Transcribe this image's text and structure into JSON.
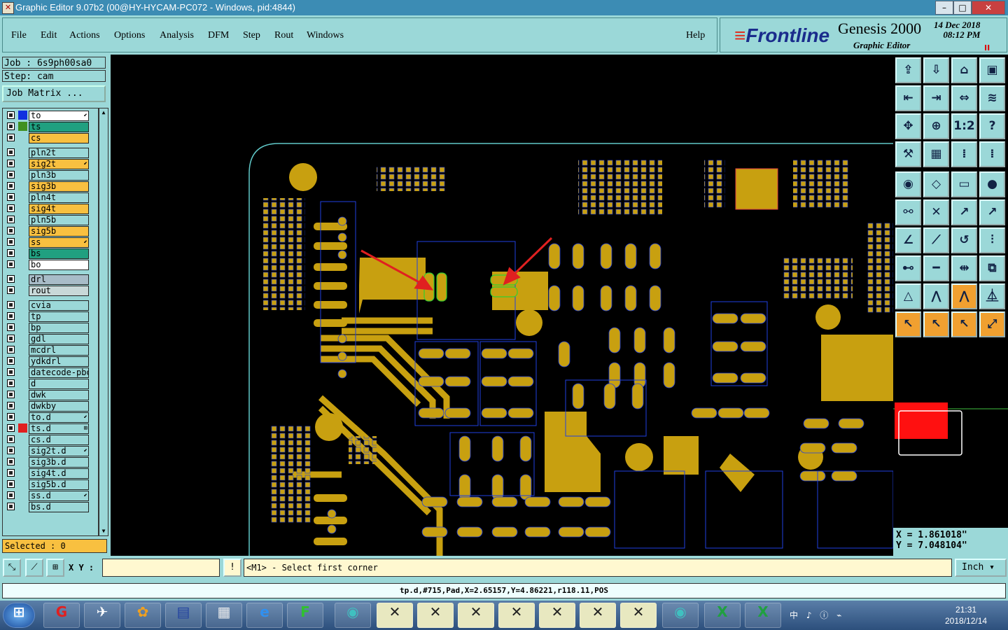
{
  "window": {
    "title": "Graphic Editor 9.07b2 (00@HY-HYCAM-PC072 - Windows, pid:4844)",
    "controls": [
      "–",
      "□",
      "✕"
    ]
  },
  "menu": {
    "items": [
      "File",
      "Edit",
      "Actions",
      "Options",
      "Analysis",
      "DFM",
      "Step",
      "Rout",
      "Windows"
    ],
    "help": "Help"
  },
  "brand": {
    "logo": "Frontline",
    "product": "Genesis 2000",
    "subtitle": "Graphic Editor",
    "date": "14  Dec  2018",
    "time": "08:12  PM",
    "pause": "II"
  },
  "job": {
    "job_line": "Job : 6s9ph00sa0",
    "step_line": "Step: cam",
    "matrix_button": "Job Matrix ..."
  },
  "layers": [
    {
      "name": "to",
      "swatch": "#1030e0",
      "bg": "#ffffff",
      "mark": "⬋"
    },
    {
      "name": "ts",
      "swatch": "#409020",
      "bg": "#20a080",
      "mark": ""
    },
    {
      "name": "cs",
      "swatch": "",
      "bg": "#f8c040",
      "mark": ""
    },
    {
      "name": "pln2t",
      "swatch": "",
      "bg": "#9bd8d8",
      "mark": ""
    },
    {
      "name": "sig2t",
      "swatch": "",
      "bg": "#f8c040",
      "mark": "⬋"
    },
    {
      "name": "pln3b",
      "swatch": "",
      "bg": "#9bd8d8",
      "mark": ""
    },
    {
      "name": "sig3b",
      "swatch": "",
      "bg": "#f8c040",
      "mark": ""
    },
    {
      "name": "pln4t",
      "swatch": "",
      "bg": "#9bd8d8",
      "mark": ""
    },
    {
      "name": "sig4t",
      "swatch": "",
      "bg": "#f8c040",
      "mark": ""
    },
    {
      "name": "pln5b",
      "swatch": "",
      "bg": "#9bd8d8",
      "mark": ""
    },
    {
      "name": "sig5b",
      "swatch": "",
      "bg": "#f8c040",
      "mark": ""
    },
    {
      "name": "ss",
      "swatch": "",
      "bg": "#f8c040",
      "mark": "⬋"
    },
    {
      "name": "bs",
      "swatch": "",
      "bg": "#20a080",
      "mark": ""
    },
    {
      "name": "bo",
      "swatch": "",
      "bg": "#ffffff",
      "mark": ""
    },
    {
      "name": "drl",
      "swatch": "",
      "bg": "#a8bcc8",
      "mark": ""
    },
    {
      "name": "rout",
      "swatch": "",
      "bg": "#c8d8d8",
      "mark": ""
    },
    {
      "name": "cvia",
      "swatch": "",
      "bg": "#9bd8d8",
      "mark": ""
    },
    {
      "name": "tp",
      "swatch": "",
      "bg": "#9bd8d8",
      "mark": ""
    },
    {
      "name": "bp",
      "swatch": "",
      "bg": "#9bd8d8",
      "mark": ""
    },
    {
      "name": "gdl",
      "swatch": "",
      "bg": "#9bd8d8",
      "mark": ""
    },
    {
      "name": "mcdrl",
      "swatch": "",
      "bg": "#9bd8d8",
      "mark": ""
    },
    {
      "name": "ydkdrl",
      "swatch": "",
      "bg": "#9bd8d8",
      "mark": ""
    },
    {
      "name": "datecode-pbo",
      "swatch": "",
      "bg": "#9bd8d8",
      "mark": ""
    },
    {
      "name": "d",
      "swatch": "",
      "bg": "#9bd8d8",
      "mark": ""
    },
    {
      "name": "dwk",
      "swatch": "",
      "bg": "#9bd8d8",
      "mark": ""
    },
    {
      "name": "dwkby",
      "swatch": "",
      "bg": "#9bd8d8",
      "mark": ""
    },
    {
      "name": "to.d",
      "swatch": "",
      "bg": "#9bd8d8",
      "mark": "⬋"
    },
    {
      "name": "ts.d",
      "swatch": "#e02020",
      "bg": "#9bd8d8",
      "mark": "⊞"
    },
    {
      "name": "cs.d",
      "swatch": "",
      "bg": "#9bd8d8",
      "mark": ""
    },
    {
      "name": "sig2t.d",
      "swatch": "",
      "bg": "#9bd8d8",
      "mark": "⬋"
    },
    {
      "name": "sig3b.d",
      "swatch": "",
      "bg": "#9bd8d8",
      "mark": ""
    },
    {
      "name": "sig4t.d",
      "swatch": "",
      "bg": "#9bd8d8",
      "mark": ""
    },
    {
      "name": "sig5b.d",
      "swatch": "",
      "bg": "#9bd8d8",
      "mark": ""
    },
    {
      "name": "ss.d",
      "swatch": "",
      "bg": "#9bd8d8",
      "mark": "⬋"
    },
    {
      "name": "bs.d",
      "swatch": "",
      "bg": "#9bd8d8",
      "mark": ""
    }
  ],
  "selected": "Selected : 0",
  "coords": {
    "x": "X = 1.861018\"",
    "y": "Y = 7.048104\""
  },
  "command": {
    "xy_label": "X Y :",
    "xy_value": "",
    "prompt_icon": "!",
    "prompt": "<M1> - Select first corner",
    "units": "Inch ▾"
  },
  "status": "tp.d,#715,Pad,X=2.65157,Y=4.86221,r118.11,POS",
  "taskbar": {
    "time": "21:31",
    "date": "2018/12/14",
    "tray": "中 ♪ ⓘ ⌁"
  },
  "colors": {
    "ui": "#9bd8d8",
    "copper": "#c8a010",
    "outline": "#2040e0",
    "arrow": "#e02020",
    "board_edge": "#60c8c8"
  }
}
